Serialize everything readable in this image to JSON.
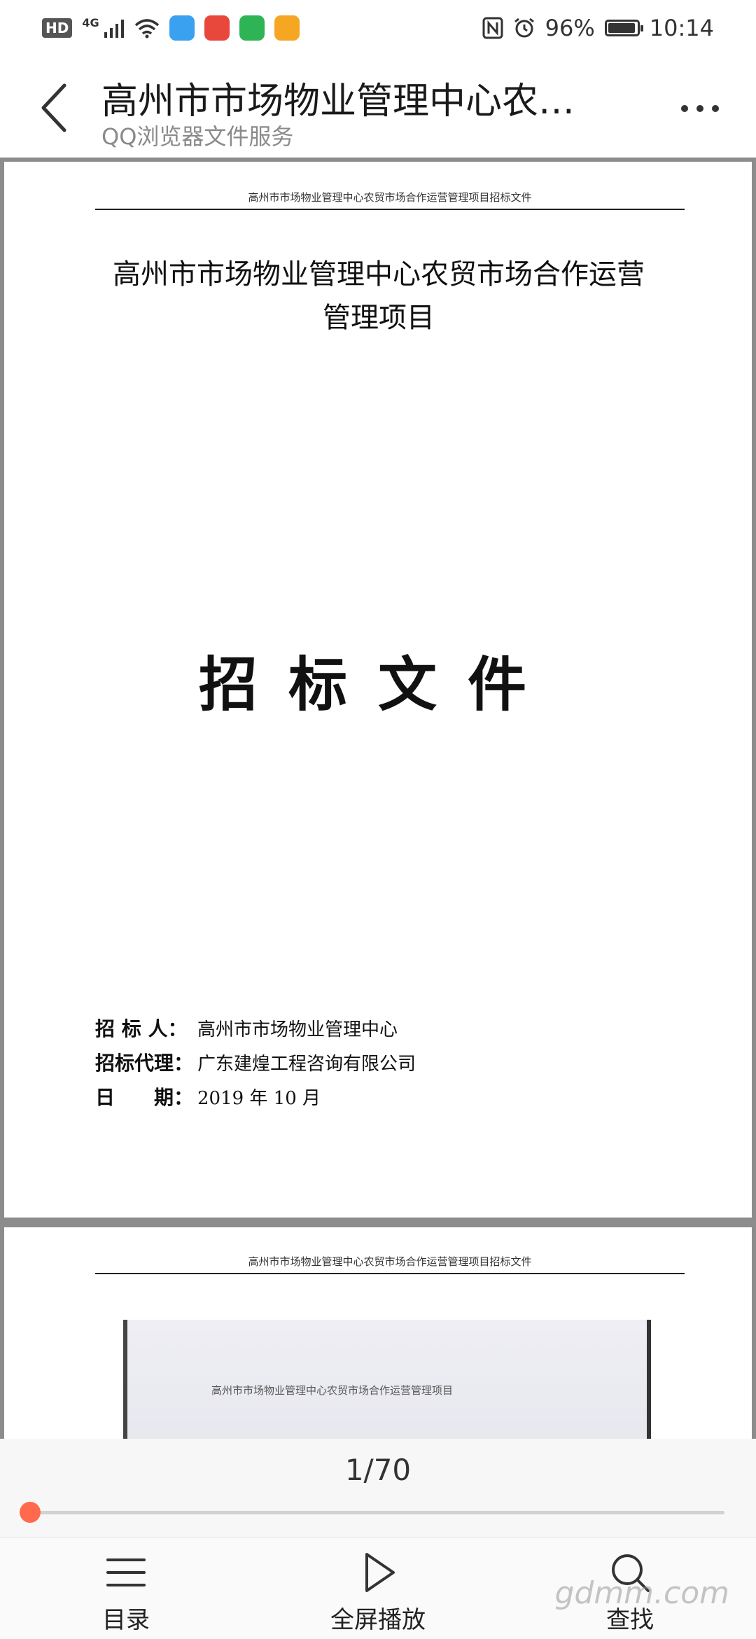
{
  "status_bar": {
    "hd": "HD",
    "network": "4G",
    "battery_percent_text": "96%",
    "battery_level": 0.96,
    "time": "10:14",
    "app_icon_colors": [
      "#3aa0f0",
      "#e8473b",
      "#2fb455",
      "#f5a623"
    ]
  },
  "header": {
    "title": "高州市市场物业管理中心农…",
    "subtitle": "QQ浏览器文件服务"
  },
  "document": {
    "page1": {
      "running_head": "高州市市场物业管理中心农贸市场合作运营管理项目招标文件",
      "title_line1": "高州市市场物业管理中心农贸市场合作运营",
      "title_line2": "管理项目",
      "big_title": "招标文件",
      "meta": [
        {
          "label": "招 标 人：",
          "value": "高州市市场物业管理中心"
        },
        {
          "label": "招标代理：",
          "value": "广东建煌工程咨询有限公司"
        },
        {
          "label": "日　　期：",
          "value": "2019 年  10 月"
        }
      ]
    },
    "page2": {
      "running_head": "高州市市场物业管理中心农贸市场合作运营管理项目招标文件",
      "photo_text": "高州市市场物业管理中心农贸市场合作运营管理项目"
    }
  },
  "pager": {
    "text": "1/70",
    "current": 1,
    "total": 70,
    "accent": "#ff6a4d"
  },
  "toolbar": {
    "contents_label": "目录",
    "fullscreen_label": "全屏播放",
    "search_label": "查找"
  },
  "watermark": "gdmm.com"
}
